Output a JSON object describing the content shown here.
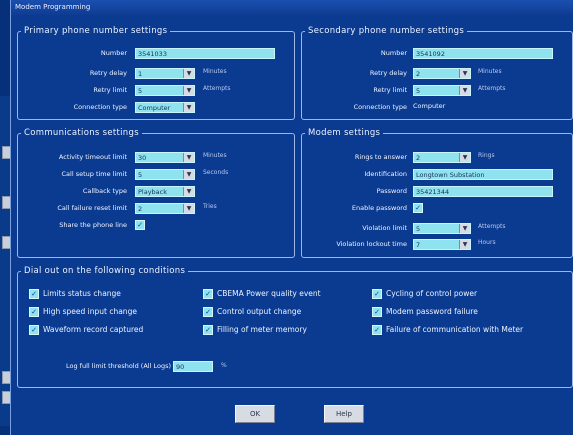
{
  "window_title": "Modem Programming",
  "primary": {
    "legend": "Primary phone number settings",
    "number_label": "Number",
    "number_value": "3541033",
    "retry_delay_label": "Retry delay",
    "retry_delay_value": "1",
    "retry_delay_unit": "Minutes",
    "retry_limit_label": "Retry limit",
    "retry_limit_value": "5",
    "retry_limit_unit": "Attempts",
    "connection_type_label": "Connection type",
    "connection_type_value": "Computer"
  },
  "secondary": {
    "legend": "Secondary phone number settings",
    "number_label": "Number",
    "number_value": "3541092",
    "retry_delay_label": "Retry delay",
    "retry_delay_value": "2",
    "retry_delay_unit": "Minutes",
    "retry_limit_label": "Retry limit",
    "retry_limit_value": "5",
    "retry_limit_unit": "Attempts",
    "connection_type_label": "Connection type",
    "connection_type_value": "Computer"
  },
  "comms": {
    "legend": "Communications settings",
    "activity_label": "Activity timeout limit",
    "activity_value": "30",
    "activity_unit": "Minutes",
    "callsetup_label": "Call setup time limit",
    "callsetup_value": "5",
    "callsetup_unit": "Seconds",
    "callback_label": "Callback type",
    "callback_value": "Playback",
    "callfail_label": "Call failure reset limit",
    "callfail_value": "2",
    "callfail_unit": "Tries",
    "share_label": "Share the phone line",
    "share_checked": "✓"
  },
  "modem": {
    "legend": "Modem settings",
    "rings_label": "Rings to answer",
    "rings_value": "2",
    "rings_unit": "Rings",
    "ident_label": "Identification",
    "ident_value": "Longtown Substation",
    "password_label": "Password",
    "password_value": "35421344",
    "enable_pw_label": "Enable password",
    "enable_pw_checked": "✓",
    "violation_limit_label": "Violation limit",
    "violation_limit_value": "5",
    "violation_limit_unit": "Attempts",
    "violation_lockout_label": "Violation lockout time",
    "violation_lockout_value": "7",
    "violation_lockout_unit": "Hours"
  },
  "dialout": {
    "legend": "Dial out on the following conditions",
    "conditions": [
      "Limits status change",
      "CBEMA Power quality event",
      "Cycling of control power",
      "High speed input change",
      "Control output change",
      "Modem password failure",
      "Waveform record captured",
      "Filling of meter memory",
      "Failure of communication with Meter"
    ],
    "log_label": "Log full limit threshold (All Logs)",
    "log_value": "90",
    "log_unit": "%"
  },
  "buttons": {
    "ok": "OK",
    "help": "Help"
  },
  "check_mark": "✓",
  "dropdown_arrow": "▼"
}
